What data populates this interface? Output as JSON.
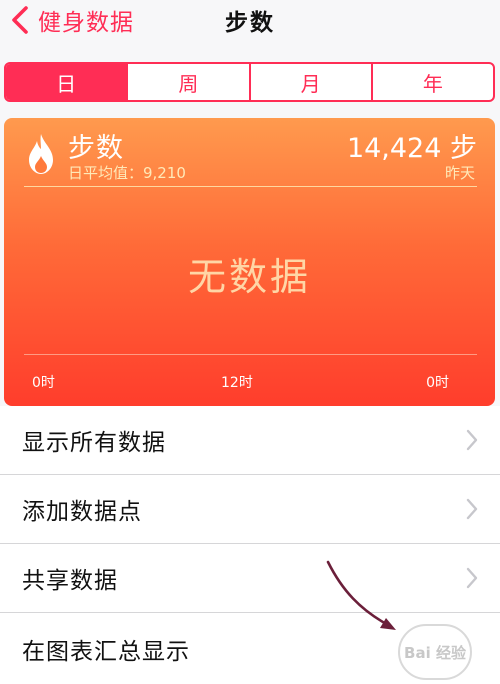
{
  "nav": {
    "back_label": "健身数据",
    "title": "步数"
  },
  "segments": [
    {
      "label": "日",
      "active": true
    },
    {
      "label": "周",
      "active": false
    },
    {
      "label": "月",
      "active": false
    },
    {
      "label": "年",
      "active": false
    }
  ],
  "card": {
    "title": "步数",
    "average": "日平均值：9,210",
    "value": "14,424 步",
    "date": "昨天",
    "no_data": "无数据",
    "ticks": [
      "0时",
      "12时",
      "0时"
    ]
  },
  "list": [
    {
      "label": "显示所有数据",
      "chevron": true
    },
    {
      "label": "添加数据点",
      "chevron": true
    },
    {
      "label": "共享数据",
      "chevron": true
    },
    {
      "label": "在图表汇总显示",
      "chevron": false
    }
  ],
  "watermark": {
    "text": "Bai 经验"
  },
  "colors": {
    "accent": "#ff2d55",
    "card_top": "#ff9a4e",
    "card_bottom": "#ff3d2c",
    "annotation_arrow": "#6b1f3a"
  },
  "icons": {
    "back": "chevron-left-icon",
    "card": "flame-icon",
    "row": "chevron-right-icon"
  }
}
